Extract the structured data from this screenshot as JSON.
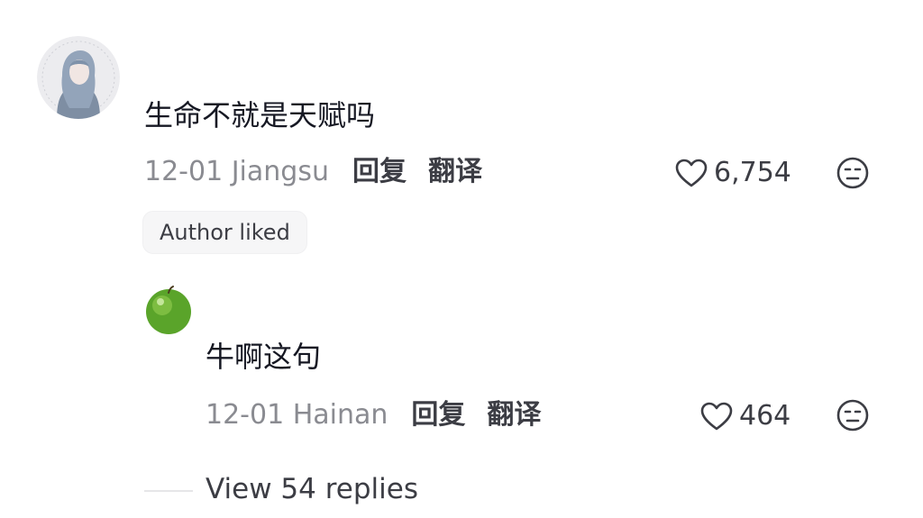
{
  "comment": {
    "text": "生命不就是天赋吗",
    "date_location": "12-01 Jiangsu",
    "reply_label": "回复",
    "translate_label": "翻译",
    "like_count": "6,754",
    "author_liked_badge": "Author liked"
  },
  "reply": {
    "text": "牛啊这句",
    "date_location": "12-01 Hainan",
    "reply_label": "回复",
    "translate_label": "翻译",
    "like_count": "464"
  },
  "view_replies_label": "View 54 replies",
  "icons": {
    "like": "heart-outline-icon",
    "dislike": "meh-face-icon"
  },
  "colors": {
    "primary_text": "#161823",
    "secondary_text": "#8a8b91",
    "action_text": "#3c3d44",
    "badge_bg": "#f6f6f7"
  }
}
